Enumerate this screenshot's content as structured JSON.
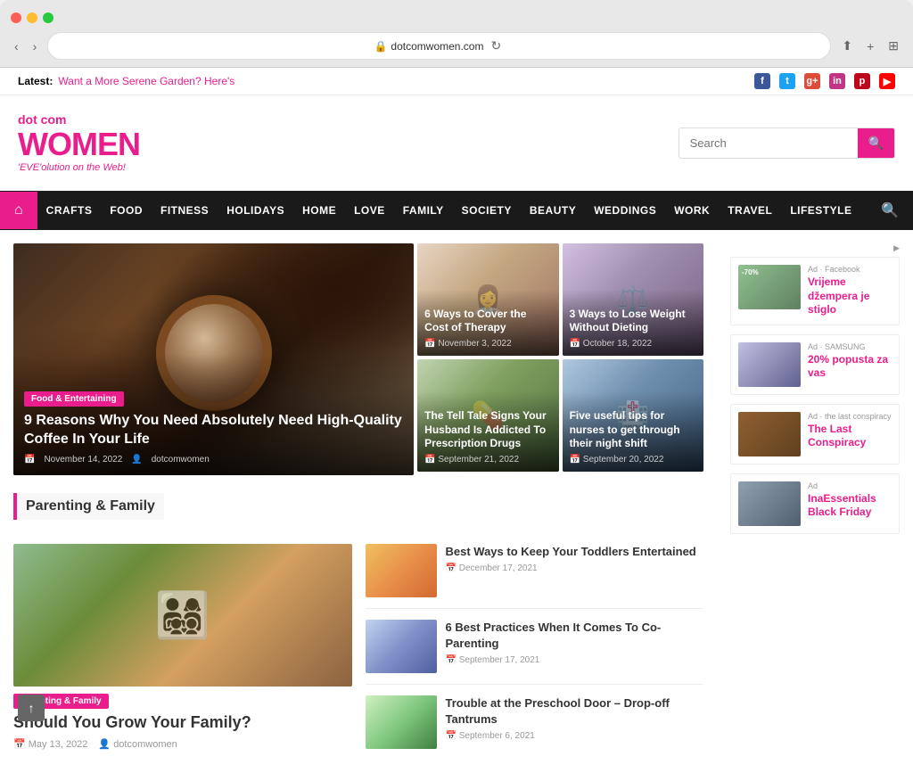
{
  "browser": {
    "url": "dotcomwomen.com",
    "reload_label": "↻"
  },
  "topbar": {
    "latest_label": "Latest:",
    "latest_link": "Want a More Serene Garden? Here's",
    "social": [
      "f",
      "t",
      "g+",
      "in",
      "p",
      "▶"
    ]
  },
  "logo": {
    "dotcom": "dot com",
    "women": "WOMEN",
    "tagline": "'EVE'olution on the Web!"
  },
  "search": {
    "placeholder": "Search",
    "btn_icon": "🔍"
  },
  "nav": {
    "home_icon": "⌂",
    "items": [
      "CRAFTS",
      "FOOD",
      "FITNESS",
      "HOLIDAYS",
      "HOME",
      "LOVE",
      "FAMILY",
      "SOCIETY",
      "BEAUTY",
      "WEDDINGS",
      "WORK",
      "TRAVEL",
      "LIFESTYLE"
    ]
  },
  "hero": {
    "main": {
      "category": "Food & Entertaining",
      "title": "9 Reasons Why You Need Absolutely Need High-Quality Coffee In Your Life",
      "date": "November 14, 2022",
      "author": "dotcomwomen"
    },
    "side_articles": [
      {
        "title": "6 Ways to Cover the Cost of Therapy",
        "date": "November 3, 2022"
      },
      {
        "title": "3 Ways to Lose Weight Without Dieting",
        "date": "October 18, 2022"
      },
      {
        "title": "The Tell Tale Signs Your Husband Is Addicted To Prescription Drugs",
        "date": "September 21, 2022"
      },
      {
        "title": "Five useful tips for nurses to get through their night shift",
        "date": "September 20, 2022"
      }
    ]
  },
  "parenting": {
    "section_title": "Parenting & Family",
    "main": {
      "category": "Parenting & Family",
      "title": "Should You Grow Your Family?",
      "date": "May 13, 2022",
      "author": "dotcomwomen"
    },
    "articles": [
      {
        "title": "Best Ways to Keep Your Toddlers Entertained",
        "date": "December 17, 2021"
      },
      {
        "title": "6 Best Practices When It Comes To Co-Parenting",
        "date": "September 17, 2021"
      },
      {
        "title": "Trouble at the Preschool Door – Drop-off Tantrums",
        "date": "September 6, 2021"
      }
    ]
  },
  "ads": [
    {
      "label": "Ad · Facebook",
      "title": "Vrijeme džempera je stiglo",
      "badge": "-70%",
      "marker": "▶"
    },
    {
      "label": "Ad · SAMSUNG",
      "title": "20% popusta za vas",
      "badge": "",
      "marker": ""
    },
    {
      "label": "Ad · the last conspiracy",
      "title": "The Last Conspiracy",
      "badge": "",
      "marker": ""
    },
    {
      "label": "Ad",
      "title": "InaEssentials Black Friday",
      "badge": "",
      "marker": ""
    }
  ],
  "scroll": {
    "btn_label": "↑"
  }
}
